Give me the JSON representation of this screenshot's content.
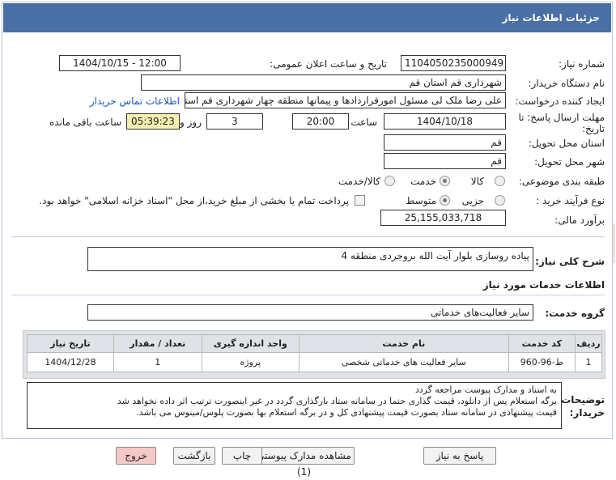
{
  "title": "جزئیات اطلاعات نیاز",
  "watermark_text": "AriaTender.neT",
  "fields": {
    "need_number_label": "شماره نیاز:",
    "need_number": "1104050235000949",
    "announce_label": "تاریخ و ساعت اعلان عمومی:",
    "announce_value": "1404/10/15 - 12:00",
    "buyer_org_label": "نام دستگاه خریدار:",
    "buyer_org": "شهرداری قم استان قم",
    "requester_label": "ایجاد کننده درخواست:",
    "requester": "علی رضا ملک لی مسئول امورقراردادها و پیمانها منطقه چهار  شهرداری قم استان قم",
    "contact_link": "اطلاعات تماس خریدار",
    "deadline_label_1": "مهلت ارسال پاسخ: تا",
    "deadline_label_2": "تاریخ:",
    "deadline_date": "1404/10/18",
    "time_label": "ساعت",
    "deadline_time": "20:00",
    "days_value": "3",
    "days_label": "روز و",
    "remaining_time": "05:39:23",
    "remaining_label": "ساعت باقی مانده",
    "delivery_province_label": "استان محل تحویل:",
    "delivery_province": "قم",
    "delivery_city_label": "شهر محل تحویل:",
    "delivery_city": "قم",
    "category_label": "طبقه بندی موضوعی:",
    "category_options": [
      "کالا",
      "خدمت",
      "کالا/خدمت"
    ],
    "category_selected": "خدمت",
    "process_label": "نوع فرآیند خرید :",
    "process_options": [
      "جزیی",
      "متوسط"
    ],
    "process_selected": "متوسط",
    "payment_note": "پرداخت تمام یا بخشی از مبلغ خرید،از محل \"اسناد خزانه اسلامی\" خواهد بود.",
    "estimate_label": "برآورد مالی:",
    "estimate_value": "25,155,033,718"
  },
  "summary": {
    "label": "شرح کلی نیاز:",
    "value": "پیاده روسازی بلوار آیت الله بروجردی منطقه 4"
  },
  "services_header": "اطلاعات خدمات مورد نیاز",
  "service_group": {
    "label": "گروه خدمت:",
    "value": "سایر فعالیت‌های خدماتی"
  },
  "table": {
    "headers": [
      "ردیف",
      "کد خدمت",
      "نام خدمت",
      "واحد اندازه گیری",
      "تعداد / مقدار",
      "تاریخ نیاز"
    ],
    "rows": [
      [
        "1",
        "ط-96-960",
        "سایر فعالیت های خدماتی شخصی",
        "پروژه",
        "1",
        "1404/12/28"
      ]
    ]
  },
  "buyer_notes": {
    "label_1": "توضیحات",
    "label_2": "خریدار:",
    "line1": "به اسناد و مدارک پیوست مراجعه گردد",
    "line2": "برگه استعلام پس از دانلود، قیمت گذاری حتما در سامانه ستاد بارگذاری گردد در غیر اینصورت ترتیب اثر داده نخواهد شد",
    "line3": "قیمت پیشنهادی در سامانه ستاد بصورت قیمت پیشنهادی کل و در برگه استعلام بها بصورت پلوس/مینوس می باشد."
  },
  "buttons": {
    "reply": "پاسخ به نیاز",
    "attachments": "مشاهده مدارک پیوستی (1)",
    "print": "چاپ",
    "back": "بازگشت",
    "exit": "خروج"
  },
  "colors": {
    "titlebar": "#4a6fa5",
    "remaining_bg": "#f5efb0",
    "exit_bg": "#f6c9c9"
  }
}
